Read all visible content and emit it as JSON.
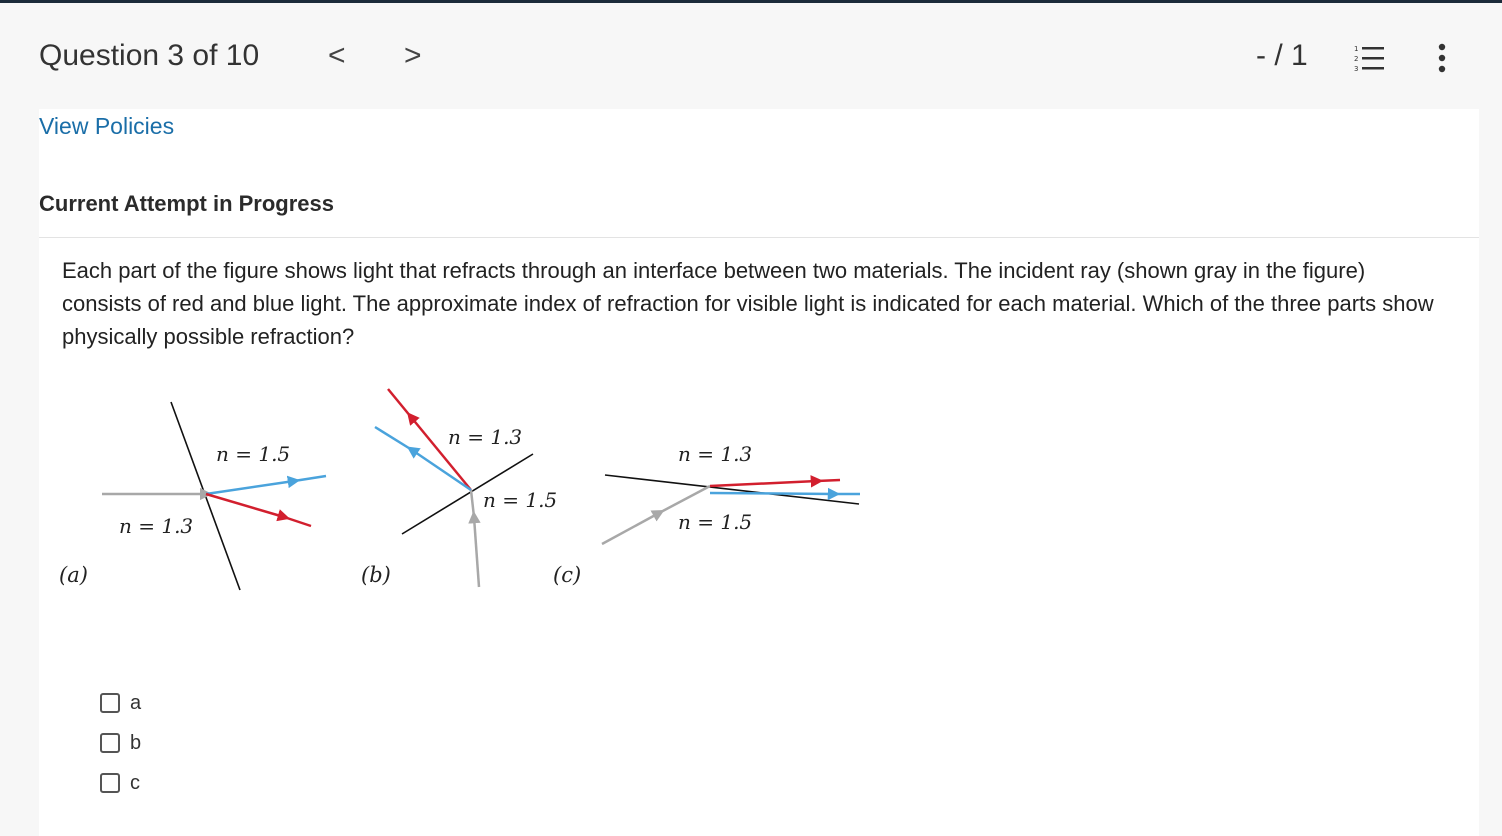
{
  "header": {
    "question_progress": "Question 3 of 10",
    "prev_label": "<",
    "next_label": ">",
    "score": "- / 1"
  },
  "links": {
    "view_policies": "View Policies"
  },
  "attempt_heading": "Current Attempt in Progress",
  "question": {
    "text": "Each part of the figure shows light that refracts through an interface between two materials. The incident ray (shown gray in the figure) consists of red and blue light. The approximate index of refraction for visible light is indicated for each material. Which of the three parts show physically possible refraction?"
  },
  "figure": {
    "part_a": {
      "label": "(a)",
      "n_top": "n = 1.5",
      "n_bottom": "n = 1.3"
    },
    "part_b": {
      "label": "(b)",
      "n_top": "n = 1.3",
      "n_bottom": "n = 1.5"
    },
    "part_c": {
      "label": "(c)",
      "n_top": "n = 1.3",
      "n_bottom": "n = 1.5"
    },
    "colors": {
      "incident": "#a8a8a8",
      "red": "#d21f2e",
      "blue": "#4aa3dc",
      "interface": "#111111"
    }
  },
  "options": [
    {
      "label": "a",
      "checked": false
    },
    {
      "label": "b",
      "checked": false
    },
    {
      "label": "c",
      "checked": false
    }
  ],
  "icons": {
    "list": "numbered-list-icon",
    "more": "vertical-ellipsis-icon"
  }
}
